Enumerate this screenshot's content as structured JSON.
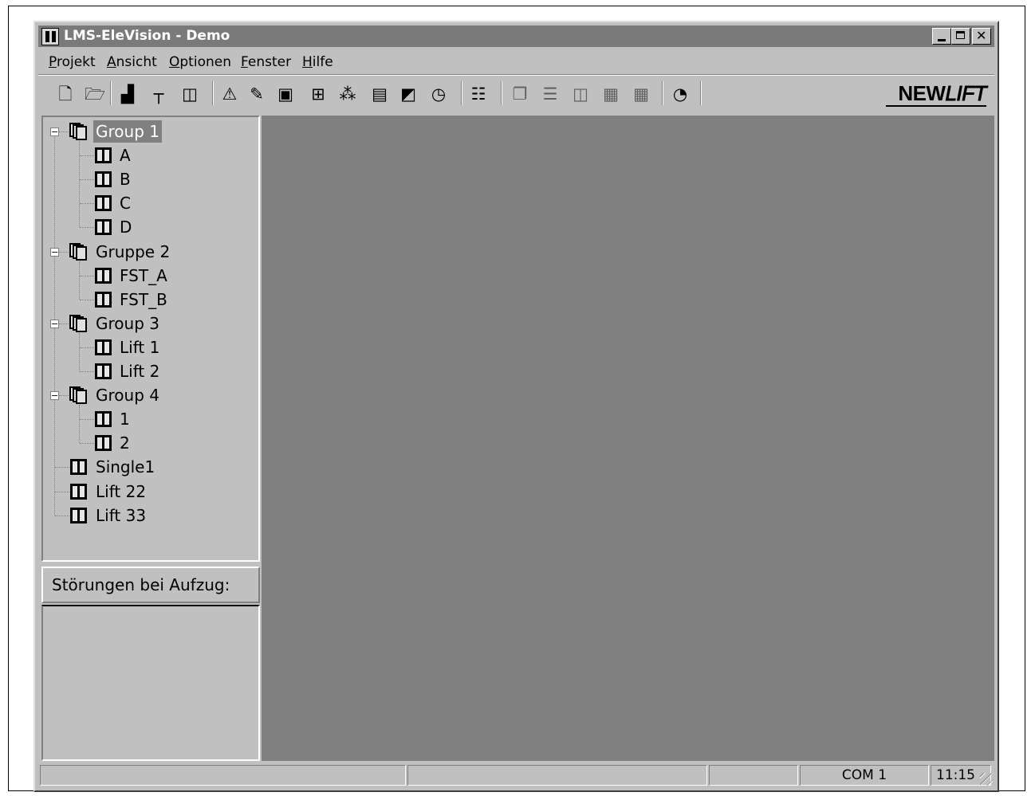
{
  "window": {
    "title": "LMS-EleVision - Demo"
  },
  "menu": {
    "items": [
      {
        "label": "Projekt",
        "key": "P",
        "rest": "rojekt"
      },
      {
        "label": "Ansicht",
        "key": "A",
        "rest": "nsicht"
      },
      {
        "label": "Optionen",
        "key": "O",
        "rest": "ptionen"
      },
      {
        "label": "Fenster",
        "key": "F",
        "rest": "enster"
      },
      {
        "label": "Hilfe",
        "key": "H",
        "rest": "ilfe"
      }
    ]
  },
  "toolbar": {
    "icons": [
      {
        "name": "new-file-icon",
        "glyph": "🗋"
      },
      {
        "name": "open-folder-icon",
        "glyph": "🗁"
      },
      {
        "name": "bar-chart-icon",
        "glyph": "▟"
      },
      {
        "name": "hierarchy-icon",
        "glyph": "┬"
      },
      {
        "name": "elevator-icon",
        "glyph": "◫"
      },
      {
        "name": "warning-icon",
        "glyph": "⚠"
      },
      {
        "name": "tools-icon",
        "glyph": "✎"
      },
      {
        "name": "frame-icon",
        "glyph": "▣"
      },
      {
        "name": "grid-icon",
        "glyph": "⊞"
      },
      {
        "name": "network-icon",
        "glyph": "⁂"
      },
      {
        "name": "save-icon",
        "glyph": "▤"
      },
      {
        "name": "display-icon",
        "glyph": "◩"
      },
      {
        "name": "clock-icon",
        "glyph": "◷"
      },
      {
        "name": "tree-view-icon",
        "glyph": "☷"
      },
      {
        "name": "cascade-windows-icon",
        "glyph": "❐"
      },
      {
        "name": "tile-horizontal-icon",
        "glyph": "☰"
      },
      {
        "name": "tile-vertical-icon",
        "glyph": "◫"
      },
      {
        "name": "view1-icon",
        "glyph": "▦"
      },
      {
        "name": "view2-icon",
        "glyph": "▦"
      },
      {
        "name": "timer-icon",
        "glyph": "◔"
      }
    ],
    "brand": {
      "new": "NEW",
      "lift": "LIFT"
    }
  },
  "tree": {
    "groups": [
      {
        "label": "Group 1",
        "children": [
          "A",
          "B",
          "C",
          "D"
        ]
      },
      {
        "label": "Gruppe 2",
        "children": [
          "FST_A",
          "FST_B"
        ]
      },
      {
        "label": "Group 3",
        "children": [
          "Lift 1",
          "Lift 2"
        ]
      },
      {
        "label": "Group 4",
        "children": [
          "1",
          "2"
        ]
      }
    ],
    "singles": [
      "Single1",
      "Lift 22",
      "Lift 33"
    ],
    "selected": "Group 1"
  },
  "faults": {
    "header": "Störungen bei Aufzug:"
  },
  "status": {
    "port": "COM 1",
    "time": "11:15"
  },
  "colors": {
    "titlebar": "#7a7a7a",
    "face": "#c0c0c0",
    "workspace": "#808080"
  }
}
